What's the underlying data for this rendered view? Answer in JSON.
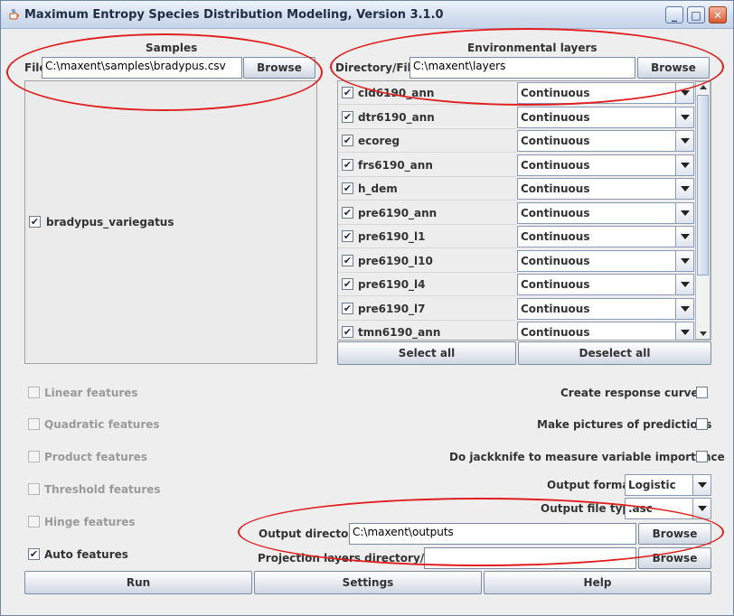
{
  "window": {
    "title": "Maximum Entropy Species Distribution Modeling, Version 3.1.0",
    "minimize": "_",
    "maximize": "□",
    "close": "✕"
  },
  "samples": {
    "heading": "Samples",
    "file_label": "File",
    "file_value": "C:\\maxent\\samples\\bradypus.csv",
    "browse": "Browse",
    "species": [
      {
        "name": "bradypus_variegatus",
        "checked": true
      }
    ]
  },
  "env": {
    "heading": "Environmental layers",
    "dir_label": "Directory/File",
    "dir_value": "C:\\maxent\\layers",
    "browse": "Browse",
    "layers": [
      {
        "name": "cld6190_ann",
        "type": "Continuous",
        "checked": true
      },
      {
        "name": "dtr6190_ann",
        "type": "Continuous",
        "checked": true
      },
      {
        "name": "ecoreg",
        "type": "Continuous",
        "checked": true
      },
      {
        "name": "frs6190_ann",
        "type": "Continuous",
        "checked": true
      },
      {
        "name": "h_dem",
        "type": "Continuous",
        "checked": true
      },
      {
        "name": "pre6190_ann",
        "type": "Continuous",
        "checked": true
      },
      {
        "name": "pre6190_l1",
        "type": "Continuous",
        "checked": true
      },
      {
        "name": "pre6190_l10",
        "type": "Continuous",
        "checked": true
      },
      {
        "name": "pre6190_l4",
        "type": "Continuous",
        "checked": true
      },
      {
        "name": "pre6190_l7",
        "type": "Continuous",
        "checked": true
      },
      {
        "name": "tmn6190_ann",
        "type": "Continuous",
        "checked": true
      }
    ],
    "select_all": "Select all",
    "deselect_all": "Deselect all"
  },
  "features": [
    {
      "label": "Linear features",
      "checked": false,
      "enabled": false
    },
    {
      "label": "Quadratic features",
      "checked": false,
      "enabled": false
    },
    {
      "label": "Product features",
      "checked": false,
      "enabled": false
    },
    {
      "label": "Threshold features",
      "checked": false,
      "enabled": false
    },
    {
      "label": "Hinge features",
      "checked": false,
      "enabled": false
    },
    {
      "label": "Auto features",
      "checked": true,
      "enabled": true
    }
  ],
  "options": {
    "response_curves": "Create response curves",
    "pictures": "Make pictures of predictions",
    "jackknife": "Do jackknife to measure variable importance",
    "output_format_label": "Output format",
    "output_format_value": "Logistic",
    "output_type_label": "Output file type",
    "output_type_value": ".asc",
    "output_dir_label": "Output directory",
    "output_dir_value": "C:\\maxent\\outputs",
    "output_browse": "Browse",
    "projection_label": "Projection layers directory/file",
    "projection_value": "",
    "projection_browse": "Browse"
  },
  "bottom": {
    "run": "Run",
    "settings": "Settings",
    "help": "Help"
  },
  "colors": {
    "annotation": "#e02020",
    "window_bg": "#eeeeee"
  }
}
